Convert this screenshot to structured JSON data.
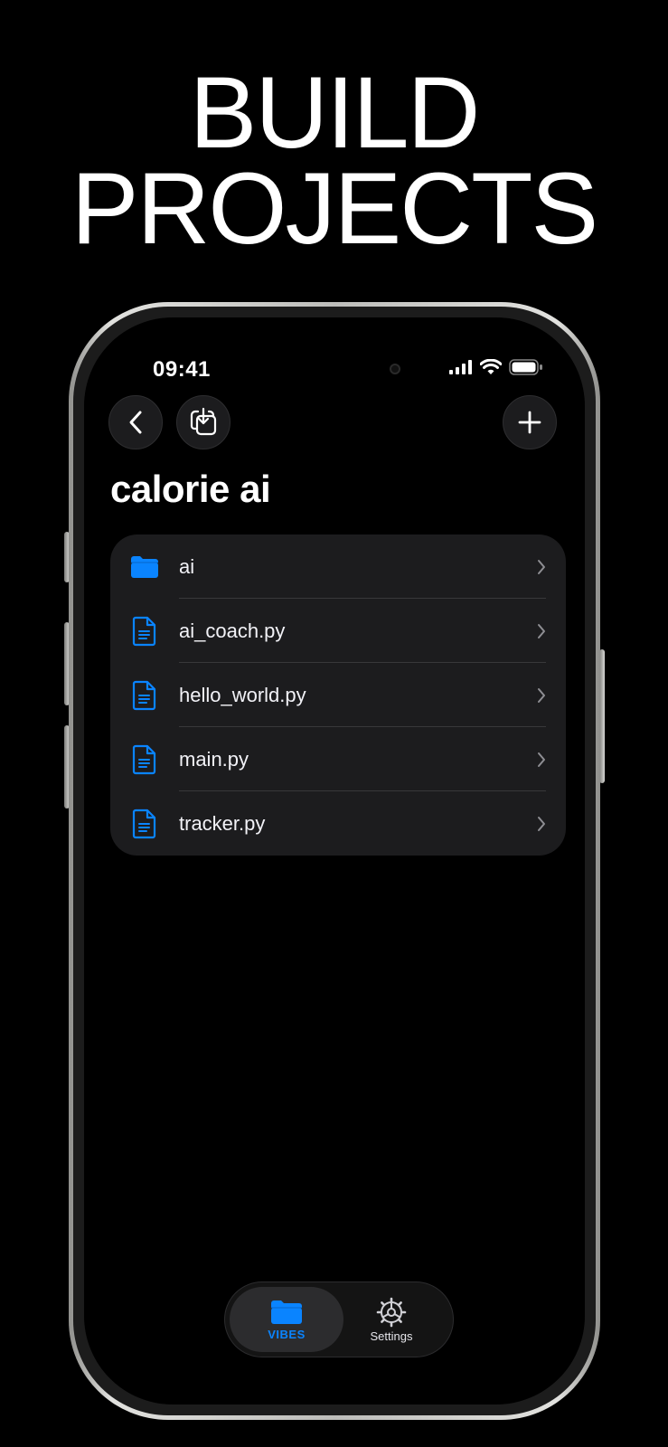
{
  "headline": {
    "line1": "BUILD",
    "line2": "PROJECTS"
  },
  "status_bar": {
    "time": "09:41"
  },
  "page": {
    "title": "calorie ai"
  },
  "files": [
    {
      "name": "ai",
      "icon": "folder-icon"
    },
    {
      "name": "ai_coach.py",
      "icon": "document-icon"
    },
    {
      "name": "hello_world.py",
      "icon": "document-icon"
    },
    {
      "name": "main.py",
      "icon": "document-icon"
    },
    {
      "name": "tracker.py",
      "icon": "document-icon"
    }
  ],
  "tabbar": {
    "tabs": [
      {
        "label": "VIBES",
        "icon": "folder-icon",
        "active": true
      },
      {
        "label": "Settings",
        "icon": "gear-icon",
        "active": false
      }
    ]
  },
  "colors": {
    "accent": "#0a84ff",
    "background": "#000000",
    "card": "#1c1c1e"
  }
}
